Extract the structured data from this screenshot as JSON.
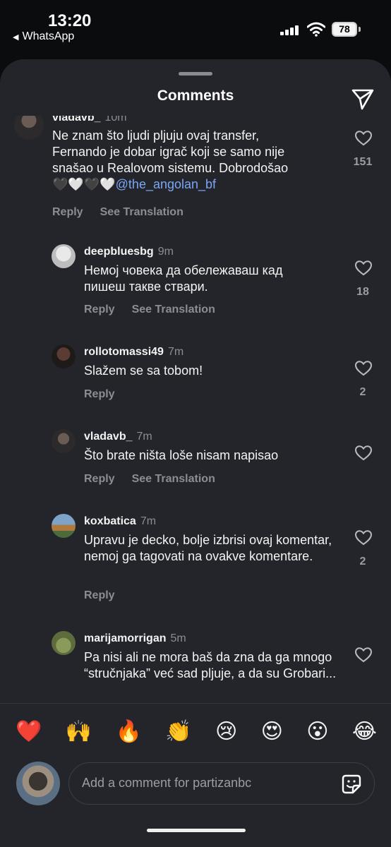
{
  "status_bar": {
    "time": "13:20",
    "back_app": "WhatsApp",
    "battery": "78"
  },
  "sheet": {
    "title": "Comments",
    "share_icon": "paper-plane-icon"
  },
  "comments": [
    {
      "username": "vladavb_",
      "ago": "10m",
      "text_parts": [
        "Ne znam što ljudi pljuju ovaj transfer,",
        "Fernando je dobar igrač koji se samo nije",
        "snašao u Realovom sistemu. Dobrodošao",
        "🖤🤍🖤🤍"
      ],
      "mention": "@the_angolan_bf",
      "reply": "Reply",
      "translate": "See Translation",
      "likes": "151"
    },
    {
      "username": "deepbluesbg",
      "ago": "9m",
      "text": "Немој човека да обележаваш кад пишеш такве ствари.",
      "reply": "Reply",
      "translate": "See Translation",
      "likes": "18"
    },
    {
      "username": "rollotomassi49",
      "ago": "7m",
      "text": "Slažem se sa tobom!",
      "reply": "Reply",
      "likes": "2"
    },
    {
      "username": "vladavb_",
      "ago": "7m",
      "text": "Što brate ništa loše nisam napisao",
      "reply": "Reply",
      "translate": "See Translation",
      "likes": ""
    },
    {
      "username": "koxbatica",
      "ago": "7m",
      "text": "Upravu je decko, bolje izbrisi ovaj komentar, nemoj ga tagovati na ovakve komentare.",
      "reply": "Reply",
      "likes": "2"
    },
    {
      "username": "marijamorrigan",
      "ago": "5m",
      "text": "Pa nisi ali ne mora baš da zna da ga mnogo “stručnjaka” već sad pljuje, a da su Grobari...",
      "likes": ""
    }
  ],
  "emoji_bar": [
    "❤️",
    "🙌",
    "🔥",
    "👏",
    "😢",
    "😍",
    "😮",
    "😂"
  ],
  "composer": {
    "placeholder": "Add a comment for partizanbc",
    "sticker_icon": "sticker-icon"
  }
}
